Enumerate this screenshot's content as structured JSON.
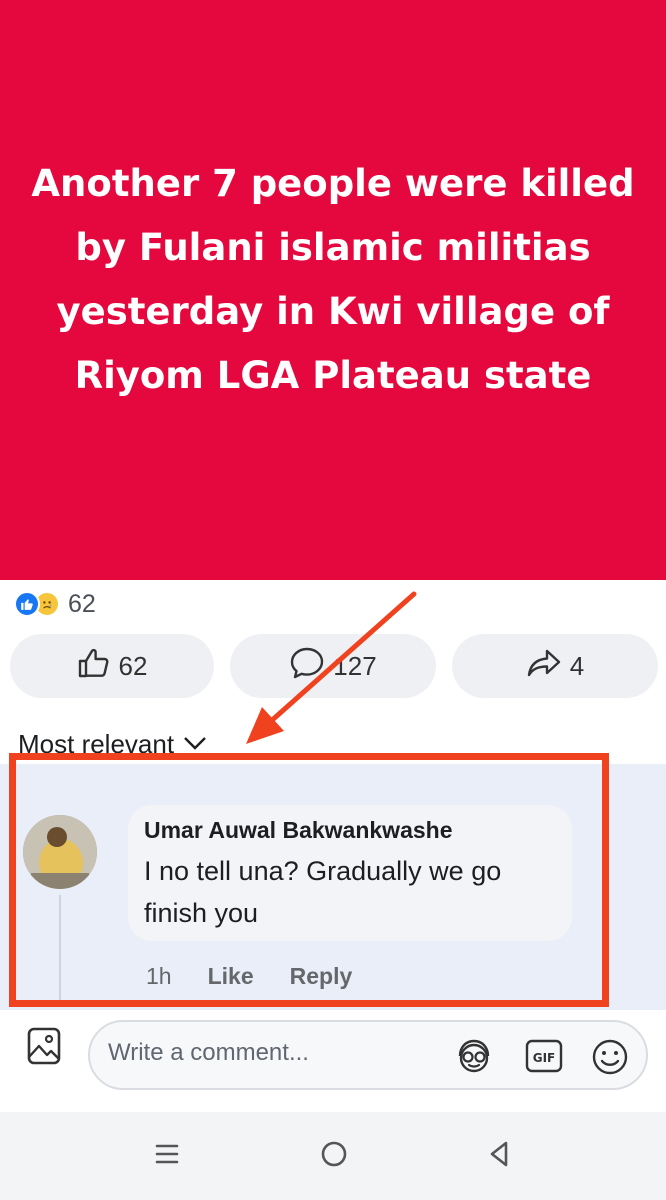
{
  "post": {
    "headline": "Another 7 people were killed by Fulani islamic militias yesterday in Kwi village of Riyom LGA Plateau state",
    "background_color": "#e4083e"
  },
  "reactions": {
    "icons": [
      "like-icon",
      "sad-icon"
    ],
    "count": "62"
  },
  "actions": {
    "like_count": "62",
    "comment_count": "127",
    "share_count": "4"
  },
  "comments": {
    "sort_label": "Most relevant",
    "items": [
      {
        "author": "Umar Auwal Bakwankwashe",
        "text": "I no tell una? Gradually we go finish you",
        "time": "1h",
        "like_label": "Like",
        "reply_label": "Reply"
      }
    ]
  },
  "composer": {
    "placeholder": "Write a comment...",
    "gif_label": "GIF"
  },
  "annotation": {
    "color": "#f0421e"
  }
}
